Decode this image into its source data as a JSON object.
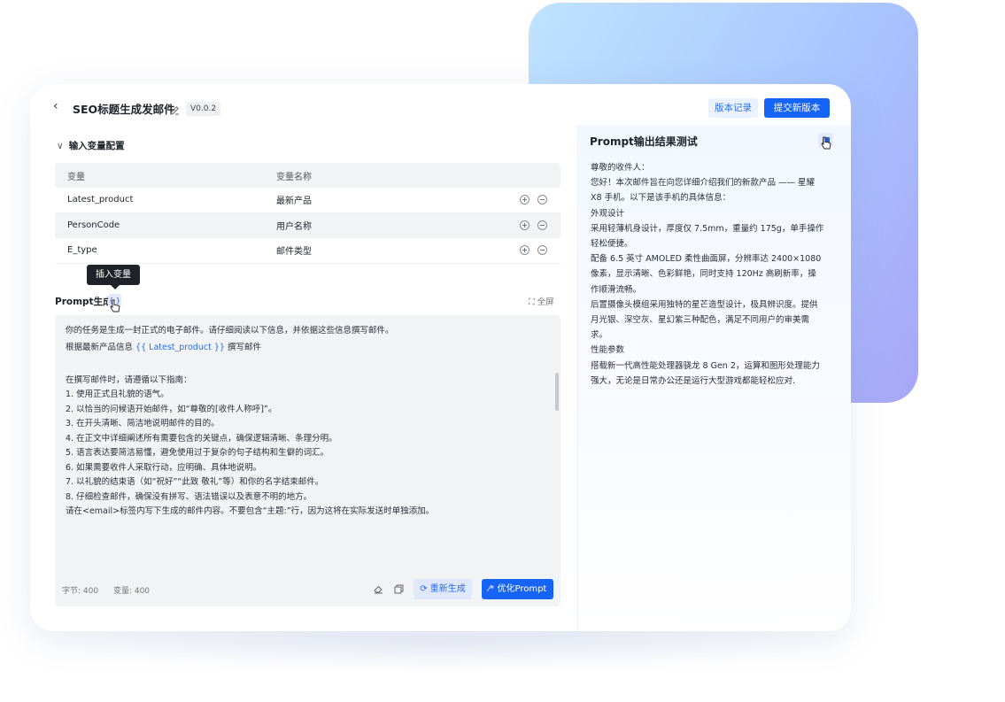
{
  "header": {
    "back_icon": "chevron-left-icon",
    "title": "SEO标题生成发邮件",
    "edit_icon": "pencil-icon",
    "version": "V0.0.2",
    "history_label": "版本记录",
    "submit_label": "提交新版本"
  },
  "variables": {
    "section_title": "输入变量配置",
    "columns": [
      "变量",
      "变量名称"
    ],
    "rows": [
      {
        "name": "Latest_product",
        "label": "最新产品"
      },
      {
        "name": "PersonCode",
        "label": "用户名称"
      },
      {
        "name": "E_type",
        "label": "邮件类型"
      }
    ]
  },
  "prompt": {
    "title": "Prompt生成",
    "tooltip": "插入变量",
    "insert_label": "{ }",
    "fullscreen_label": "全屏",
    "lines": [
      "你的任务是生成一封正式的电子邮件。请仔细阅读以下信息，并依据这些信息撰写邮件。",
      "根据最新产品信息",
      "{{ Latest_product }}",
      "撰写邮件",
      "",
      "在撰写邮件时，请遵循以下指南：",
      "1. 使用正式且礼貌的语气。",
      "2. 以恰当的问候语开始邮件，如“尊敬的[收件人称呼]”。",
      "3. 在开头清晰、简洁地说明邮件的目的。",
      "4. 在正文中详细阐述所有需要包含的关键点，确保逻辑清晰、条理分明。",
      "5. 语言表达要简洁易懂，避免使用过于复杂的句子结构和生僻的词汇。",
      "6. 如果需要收件人采取行动，应明确、具体地说明。",
      "7. 以礼貌的结束语（如“祝好”“此致 敬礼”等）和你的名字结束邮件。",
      "8. 仔细检查邮件，确保没有拼写、语法错误以及表意不明的地方。",
      "请在<email>标签内写下生成的邮件内容。不要包含“主题:”行，因为这将在实际发送时单独添加。"
    ],
    "stats": {
      "chars": "字节: 400",
      "vars": "变量: 400"
    },
    "regen_label": "重新生成",
    "optimize_label": "优化Prompt"
  },
  "output": {
    "title": "Prompt输出结果测试",
    "lines": [
      "尊敬的收件人：",
      "您好！本次邮件旨在向您详细介绍我们的新款产品 —— 星耀",
      "X8 手机。以下是该手机的具体信息：",
      "外观设计",
      "采用轻薄机身设计，厚度仅 7.5mm，重量约 175g，单手操作",
      "轻松便捷。",
      "配备 6.5 英寸 AMOLED 柔性曲面屏，分辨率达 2400×1080",
      "像素，显示清晰、色彩鲜艳，同时支持 120Hz 高刷新率，操",
      "作顺滑流畅。",
      "后置摄像头模组采用独特的星芒造型设计，极具辨识度。提供",
      "月光银、深空灰、星幻紫三种配色，满足不同用户的审美需",
      "求。",
      "性能参数",
      "搭载新一代高性能处理器骁龙 8 Gen 2，运算和图形处理能力",
      "强大，无论是日常办公还是运行大型游戏都能轻松应对."
    ]
  }
}
